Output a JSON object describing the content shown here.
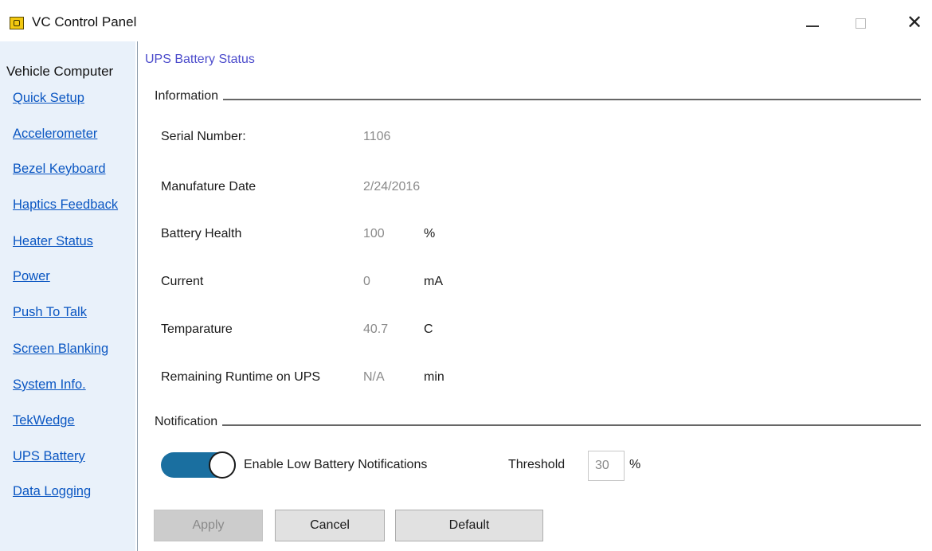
{
  "window": {
    "title": "VC Control Panel",
    "icons": {
      "app": "vc-app-icon",
      "minimize": "minimize-icon",
      "maximize": "maximize-icon",
      "close": "close-icon"
    },
    "close_glyph": "✕"
  },
  "sidebar": {
    "heading": "Vehicle Computer",
    "items": [
      {
        "label": "Quick Setup"
      },
      {
        "label": "Accelerometer"
      },
      {
        "label": "Bezel Keyboard"
      },
      {
        "label": "Haptics Feedback"
      },
      {
        "label": "Heater Status"
      },
      {
        "label": "Power"
      },
      {
        "label": "Push To Talk"
      },
      {
        "label": "Screen Blanking"
      },
      {
        "label": "System Info."
      },
      {
        "label": "TekWedge"
      },
      {
        "label": "UPS Battery"
      },
      {
        "label": "Data Logging"
      }
    ]
  },
  "main": {
    "title": "UPS Battery Status",
    "information": {
      "label": "Information",
      "fields": [
        {
          "label": "Serial Number:",
          "value": "1106",
          "unit": ""
        },
        {
          "label": "Manufature Date",
          "value": "2/24/2016",
          "unit": ""
        },
        {
          "label": "Battery Health",
          "value": "100",
          "unit": "%"
        },
        {
          "label": "Current",
          "value": "0",
          "unit": "mA"
        },
        {
          "label": "Temparature",
          "value": "40.7",
          "unit": "C"
        },
        {
          "label": "Remaining Runtime on UPS",
          "value": "N/A",
          "unit": "min"
        }
      ]
    },
    "notification": {
      "label": "Notification",
      "toggle_label": "Enable Low Battery Notifications",
      "toggle_on": true,
      "threshold_label": "Threshold",
      "threshold_value": "30",
      "threshold_unit": "%"
    },
    "buttons": {
      "apply": "Apply",
      "cancel": "Cancel",
      "default": "Default"
    }
  },
  "colors": {
    "link": "#0a56c2",
    "section_title": "#4c4ccc",
    "sidebar_bg": "#e9f1fa",
    "toggle_on": "#1a6fa0"
  }
}
